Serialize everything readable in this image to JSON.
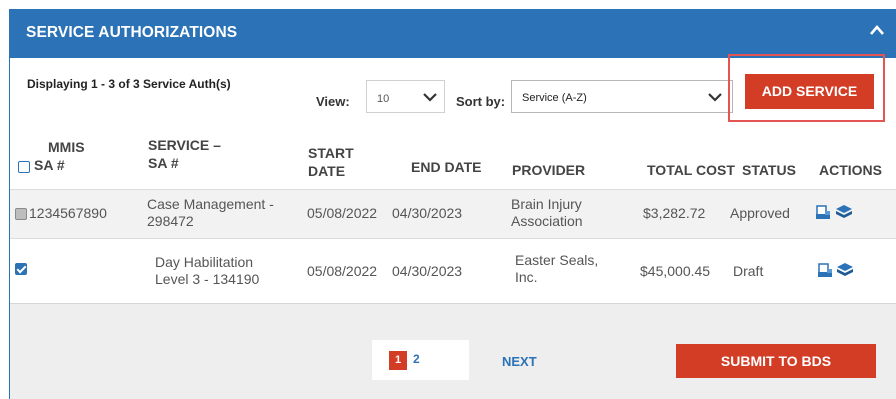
{
  "header": {
    "title": "SERVICE AUTHORIZATIONS"
  },
  "toolbar": {
    "displaying": "Displaying 1 - 3 of 3 Service Auth(s)",
    "view_label": "View:",
    "view_value": "10",
    "sort_label": "Sort by:",
    "sort_value": "Service (A-Z)",
    "add_service": "ADD SERVICE"
  },
  "table": {
    "headers": {
      "mmis_1": "MMIS",
      "mmis_2": "SA #",
      "service_1": "SERVICE –",
      "service_2": "SA #",
      "start_1": "START",
      "start_2": "DATE",
      "end": "END DATE",
      "provider": "PROVIDER",
      "total_cost": "TOTAL COST",
      "status": "STATUS",
      "actions": "ACTIONS"
    },
    "rows": [
      {
        "mmis": "1234567890",
        "service_1": "Case Management -",
        "service_2": "298472",
        "start": "05/08/2022",
        "end": "04/30/2023",
        "provider_1": "Brain Injury",
        "provider_2": "Association",
        "total": "$3,282.72",
        "status": "Approved",
        "checkbox": "indeterminate"
      },
      {
        "mmis": "",
        "service_1": "Day Habilitation",
        "service_2": "Level 3 - 134190",
        "start": "05/08/2022",
        "end": "04/30/2023",
        "provider_1": "Easter Seals,",
        "provider_2": "Inc.",
        "total": "$45,000.45",
        "status": "Draft",
        "checkbox": "checked"
      }
    ]
  },
  "pager": {
    "pages": [
      "1",
      "2"
    ],
    "current": "1",
    "next": "NEXT"
  },
  "footer": {
    "submit": "SUBMIT TO BDS"
  },
  "colors": {
    "primary_blue": "#2b72b6",
    "accent_red": "#d33c25",
    "highlight_outline": "#e25552"
  },
  "icons": [
    "chevron-up-icon",
    "chevron-down-icon",
    "print-icon",
    "book-stack-icon"
  ]
}
